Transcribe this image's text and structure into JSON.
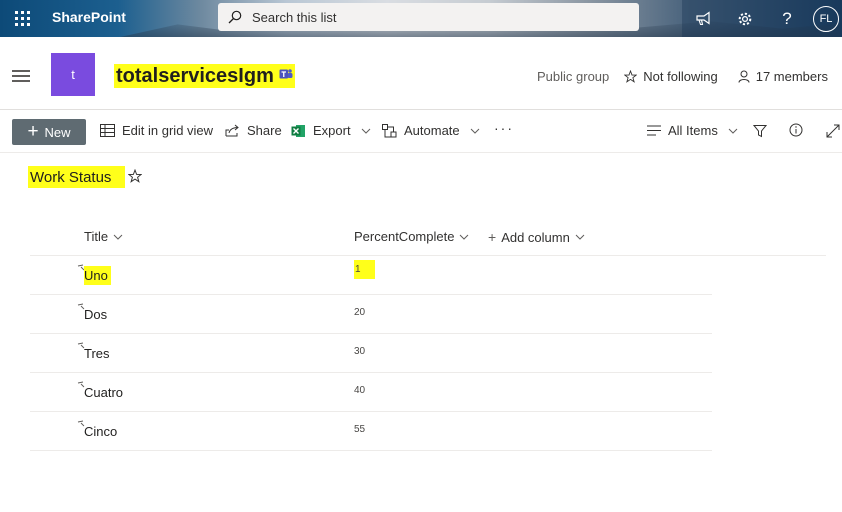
{
  "suitebar": {
    "app_name": "SharePoint",
    "search_placeholder": "Search this list",
    "avatar_initials": "FL",
    "help_label": "?"
  },
  "site": {
    "logo_letter": "t",
    "title": "totalservicesIgm",
    "group_type": "Public group",
    "follow_label": "Not following",
    "members_label": "17 members"
  },
  "commandbar": {
    "new_label": "New",
    "edit_grid_label": "Edit in grid view",
    "share_label": "Share",
    "export_label": "Export",
    "automate_label": "Automate",
    "more_label": "···",
    "view_label": "All Items"
  },
  "list": {
    "title": "Work Status",
    "columns": {
      "title": "Title",
      "percent": "PercentComplete",
      "add": "Add column"
    },
    "rows": [
      {
        "title": "Uno",
        "percent": "1"
      },
      {
        "title": "Dos",
        "percent": "20"
      },
      {
        "title": "Tres",
        "percent": "30"
      },
      {
        "title": "Cuatro",
        "percent": "40"
      },
      {
        "title": "Cinco",
        "percent": "55"
      }
    ]
  },
  "colors": {
    "highlight": "#ffff1a",
    "site_logo": "#7a4bdf",
    "new_button": "#5f6b72"
  }
}
